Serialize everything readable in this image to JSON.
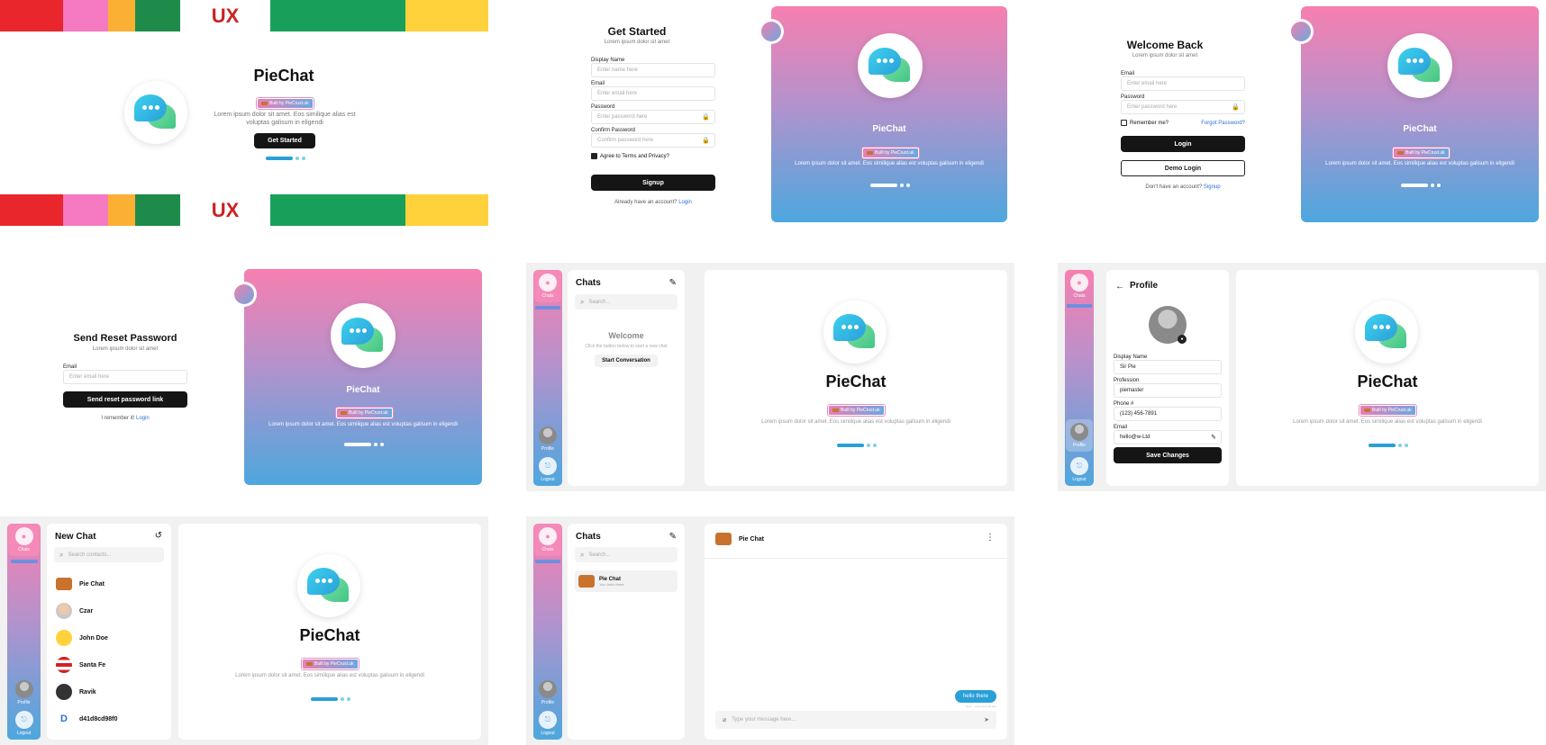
{
  "brand": {
    "app_name": "PieChat",
    "badge": "Built by PieCrust.uk"
  },
  "common": {
    "lorem_short": "Lorem ipsum dolor sit amet",
    "lorem_long": "Lorem ipsum dolor sit amet. Eos similique alias est voluptas galisum in eligendi"
  },
  "landing": {
    "title": "PieChat",
    "desc_line1": "Lorem ipsum dolor sit amet. Eos similique alias est",
    "desc_line2": "voluptas galisum in eligendi",
    "cta": "Get Started",
    "strip_text": "UX"
  },
  "signup": {
    "title": "Get Started",
    "subtitle": "Lorem ipsum dolor sit amet",
    "display_name_label": "Display Name",
    "display_name_ph": "Enter name here",
    "email_label": "Email",
    "email_ph": "Enter email here",
    "password_label": "Password",
    "password_ph": "Enter password here",
    "confirm_label": "Confirm Password",
    "confirm_ph": "Confirm password here",
    "terms": "Agree to Terms and Privacy?",
    "submit": "Signup",
    "footer_text": "Already have an account?",
    "footer_link": "Login"
  },
  "login": {
    "title": "Welcome Back",
    "subtitle": "Lorem ipsum dolor sit amet",
    "email_label": "Email",
    "email_ph": "Enter email here",
    "password_label": "Password",
    "password_ph": "Enter password here",
    "remember": "Remember me?",
    "forgot": "Forgot Password?",
    "submit": "Login",
    "demo": "Demo Login",
    "footer_text": "Don't have an account?",
    "footer_link": "Signup"
  },
  "reset": {
    "title": "Send Reset Password",
    "subtitle": "Lorem ipsum dolor sit amet",
    "email_label": "Email",
    "email_ph": "Enter email here",
    "submit": "Send reset password link",
    "footer_text": "I remember it!",
    "footer_link": "Login"
  },
  "sidebar": {
    "chats": "Chats",
    "profile": "Profile",
    "logout": "Logout"
  },
  "chats_view": {
    "title": "Chats",
    "search_ph": "Search...",
    "welcome_title": "Welcome",
    "welcome_text": "Click the button below to start a new chat",
    "start": "Start Conversation"
  },
  "profile_view": {
    "title": "Profile",
    "display_name_label": "Display Name",
    "display_name_val": "Sir Pie",
    "profession_label": "Profession",
    "profession_val": "piemaster",
    "phone_label": "Phone #",
    "phone_val": "(123) 456-7891",
    "email_label": "Email",
    "email_val": "hello@w-Ltd",
    "save": "Save Changes"
  },
  "new_chat": {
    "title": "New Chat",
    "search_ph": "Search contacts...",
    "contacts": [
      "Pie Chat",
      "Czar",
      "John Doe",
      "Santa Fe",
      "Ravik",
      "d41d8cd98f0"
    ]
  },
  "conversation": {
    "title": "Chats",
    "search_ph": "Search...",
    "item_name": "Pie Chat",
    "item_preview": "You: hello there",
    "header_name": "Pie Chat",
    "message": "hello there",
    "message_meta": "Sent · a few seconds ago",
    "input_ph": "Type your message here..."
  },
  "colors": {
    "pink": "#f77fb0",
    "blue": "#4da7de",
    "black": "#151515",
    "teal": "#2a9fd8"
  }
}
